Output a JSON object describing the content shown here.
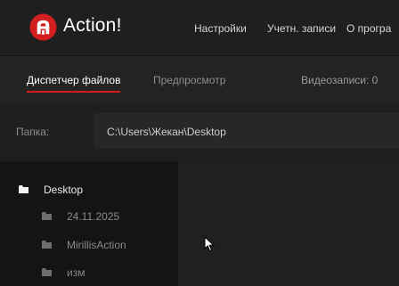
{
  "app": {
    "title": "Action!",
    "logo_icon": "action-logo-icon",
    "brand_color": "#d21e1e"
  },
  "menu": {
    "settings": "Настройки",
    "accounts": "Учетн. записи",
    "about": "О програ"
  },
  "tabs": {
    "file_manager": "Диспетчер файлов",
    "preview": "Предпросмотр",
    "active": "file_manager",
    "recordings": "Видеозаписи: 0"
  },
  "folder": {
    "label": "Папка:",
    "path": "C:\\Users\\Жекан\\Desktop"
  },
  "tree": {
    "root": {
      "label": "Desktop",
      "icon": "folder-icon"
    },
    "children": [
      {
        "label": "24.11.2025",
        "icon": "folder-icon"
      },
      {
        "label": "MirillisAction",
        "icon": "folder-icon"
      },
      {
        "label": "изм",
        "icon": "folder-icon"
      }
    ]
  }
}
